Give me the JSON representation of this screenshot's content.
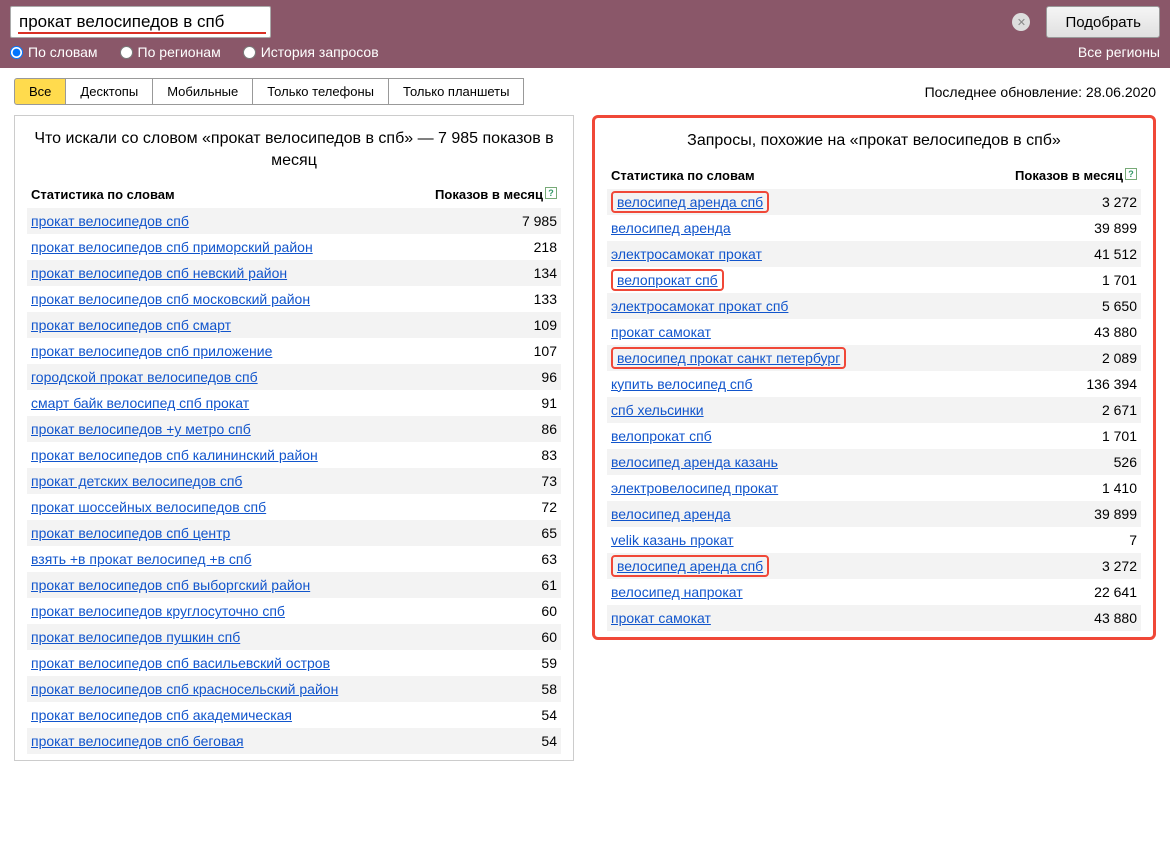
{
  "search": {
    "value": "прокат велосипедов в спб",
    "button": "Подобрать"
  },
  "radios": {
    "by_words": "По словам",
    "by_regions": "По регионам",
    "history": "История запросов"
  },
  "regions_link": "Все регионы",
  "tabs": {
    "all": "Все",
    "desktops": "Десктопы",
    "mobile": "Мобильные",
    "phones": "Только телефоны",
    "tablets": "Только планшеты"
  },
  "update_info": "Последнее обновление: 28.06.2020",
  "headers": {
    "stat": "Статистика по словам",
    "shows": "Показов в месяц"
  },
  "left": {
    "title": "Что искали со словом «прокат велосипедов в спб» — 7 985 показов в месяц",
    "rows": [
      {
        "q": "прокат велосипедов спб",
        "v": "7 985"
      },
      {
        "q": "прокат велосипедов спб приморский район",
        "v": "218"
      },
      {
        "q": "прокат велосипедов спб невский район",
        "v": "134"
      },
      {
        "q": "прокат велосипедов спб московский район",
        "v": "133"
      },
      {
        "q": "прокат велосипедов спб смарт",
        "v": "109"
      },
      {
        "q": "прокат велосипедов спб приложение",
        "v": "107"
      },
      {
        "q": "городской прокат велосипедов спб",
        "v": "96"
      },
      {
        "q": "смарт байк велосипед спб прокат",
        "v": "91"
      },
      {
        "q": "прокат велосипедов +у метро спб",
        "v": "86"
      },
      {
        "q": "прокат велосипедов спб калининский район",
        "v": "83"
      },
      {
        "q": "прокат детских велосипедов спб",
        "v": "73"
      },
      {
        "q": "прокат шоссейных велосипедов спб",
        "v": "72"
      },
      {
        "q": "прокат велосипедов спб центр",
        "v": "65"
      },
      {
        "q": "взять +в прокат велосипед +в спб",
        "v": "63"
      },
      {
        "q": "прокат велосипедов спб выборгский район",
        "v": "61"
      },
      {
        "q": "прокат велосипедов круглосуточно спб",
        "v": "60"
      },
      {
        "q": "прокат велосипедов пушкин спб",
        "v": "60"
      },
      {
        "q": "прокат велосипедов спб васильевский остров",
        "v": "59"
      },
      {
        "q": "прокат велосипедов спб красносельский район",
        "v": "58"
      },
      {
        "q": "прокат велосипедов спб академическая",
        "v": "54"
      },
      {
        "q": "прокат велосипедов спб беговая",
        "v": "54"
      }
    ]
  },
  "right": {
    "title": "Запросы, похожие на «прокат велосипедов в спб»",
    "rows": [
      {
        "q": "велосипед аренда спб",
        "v": "3 272",
        "hl": true
      },
      {
        "q": "велосипед аренда",
        "v": "39 899"
      },
      {
        "q": "электросамокат прокат",
        "v": "41 512"
      },
      {
        "q": "велопрокат спб",
        "v": "1 701",
        "hl": true
      },
      {
        "q": "электросамокат прокат спб",
        "v": "5 650"
      },
      {
        "q": "прокат самокат",
        "v": "43 880"
      },
      {
        "q": "велосипед прокат санкт петербург",
        "v": "2 089",
        "hl": true
      },
      {
        "q": "купить велосипед спб",
        "v": "136 394"
      },
      {
        "q": "спб хельсинки",
        "v": "2 671"
      },
      {
        "q": "велопрокат спб",
        "v": "1 701"
      },
      {
        "q": "велосипед аренда казань",
        "v": "526"
      },
      {
        "q": "электровелосипед прокат",
        "v": "1 410"
      },
      {
        "q": "велосипед аренда",
        "v": "39 899"
      },
      {
        "q": "velik казань прокат",
        "v": "7"
      },
      {
        "q": "велосипед аренда спб",
        "v": "3 272",
        "hl": true
      },
      {
        "q": "велосипед напрокат",
        "v": "22 641"
      },
      {
        "q": "прокат самокат",
        "v": "43 880"
      }
    ]
  }
}
